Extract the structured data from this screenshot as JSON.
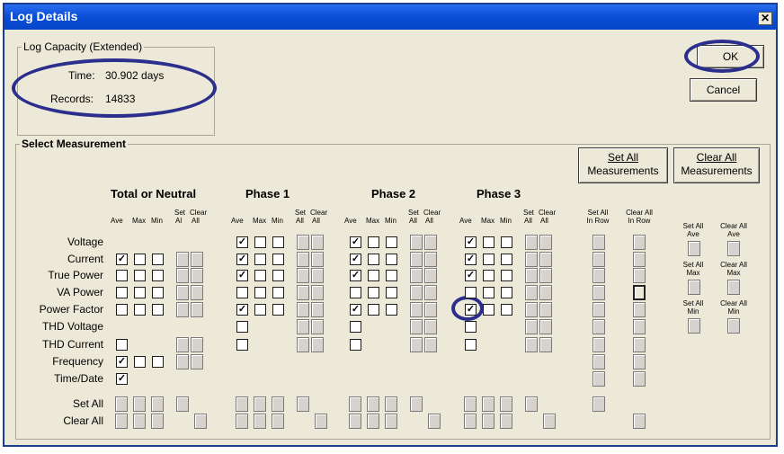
{
  "window": {
    "title": "Log Details",
    "close_glyph": "✕"
  },
  "capacity": {
    "legend": "Log Capacity (Extended)",
    "time_label": "Time:",
    "time_value": "30.902 days",
    "records_label": "Records:",
    "records_value": "14833"
  },
  "buttons": {
    "ok": "OK",
    "cancel": "Cancel"
  },
  "measure": {
    "legend": "Select Measurement",
    "set_all_line1": "Set All",
    "set_all_line2": "Measurements",
    "clear_all_line1": "Clear All",
    "clear_all_line2": "Measurements"
  },
  "groups": [
    "Total or Neutral",
    "Phase 1",
    "Phase 2",
    "Phase 3"
  ],
  "subheads": {
    "ave": "Ave",
    "max": "Max",
    "min": "Min",
    "set": "Set",
    "all": "All",
    "clear": "Clear",
    "al": "Al"
  },
  "rows": [
    "Voltage",
    "Current",
    "True Power",
    "VA Power",
    "Power Factor",
    "THD Voltage",
    "THD Current",
    "Frequency",
    "Time/Date"
  ],
  "bottom_rows": [
    "Set All",
    "Clear All"
  ],
  "col_heads": {
    "set_all": "Set All",
    "clear_all": "Clear All",
    "in_row": "In Row"
  },
  "side": {
    "set_all": "Set All",
    "clear_all": "Clear All",
    "ave": "Ave",
    "max": "Max",
    "min": "Min"
  },
  "checked_state": {
    "Total or Neutral": {
      "Current": [
        true,
        false,
        false
      ],
      "Frequency": [
        true,
        false,
        false
      ],
      "Time/Date": [
        true
      ]
    },
    "Phase 1": {
      "Voltage": [
        true,
        false,
        false
      ],
      "Current": [
        true,
        false,
        false
      ],
      "True Power": [
        true,
        false,
        false
      ],
      "Power Factor": [
        true,
        false,
        false
      ]
    },
    "Phase 2": {
      "Voltage": [
        true,
        false,
        false
      ],
      "Current": [
        true,
        false,
        false
      ],
      "True Power": [
        true,
        false,
        false
      ],
      "Power Factor": [
        true,
        false,
        false
      ]
    },
    "Phase 3": {
      "Voltage": [
        true,
        false,
        false
      ],
      "Current": [
        true,
        false,
        false
      ],
      "True Power": [
        true,
        false,
        false
      ],
      "Power Factor": [
        true,
        false,
        false
      ]
    }
  },
  "annotation_color": "#2b2e8c"
}
